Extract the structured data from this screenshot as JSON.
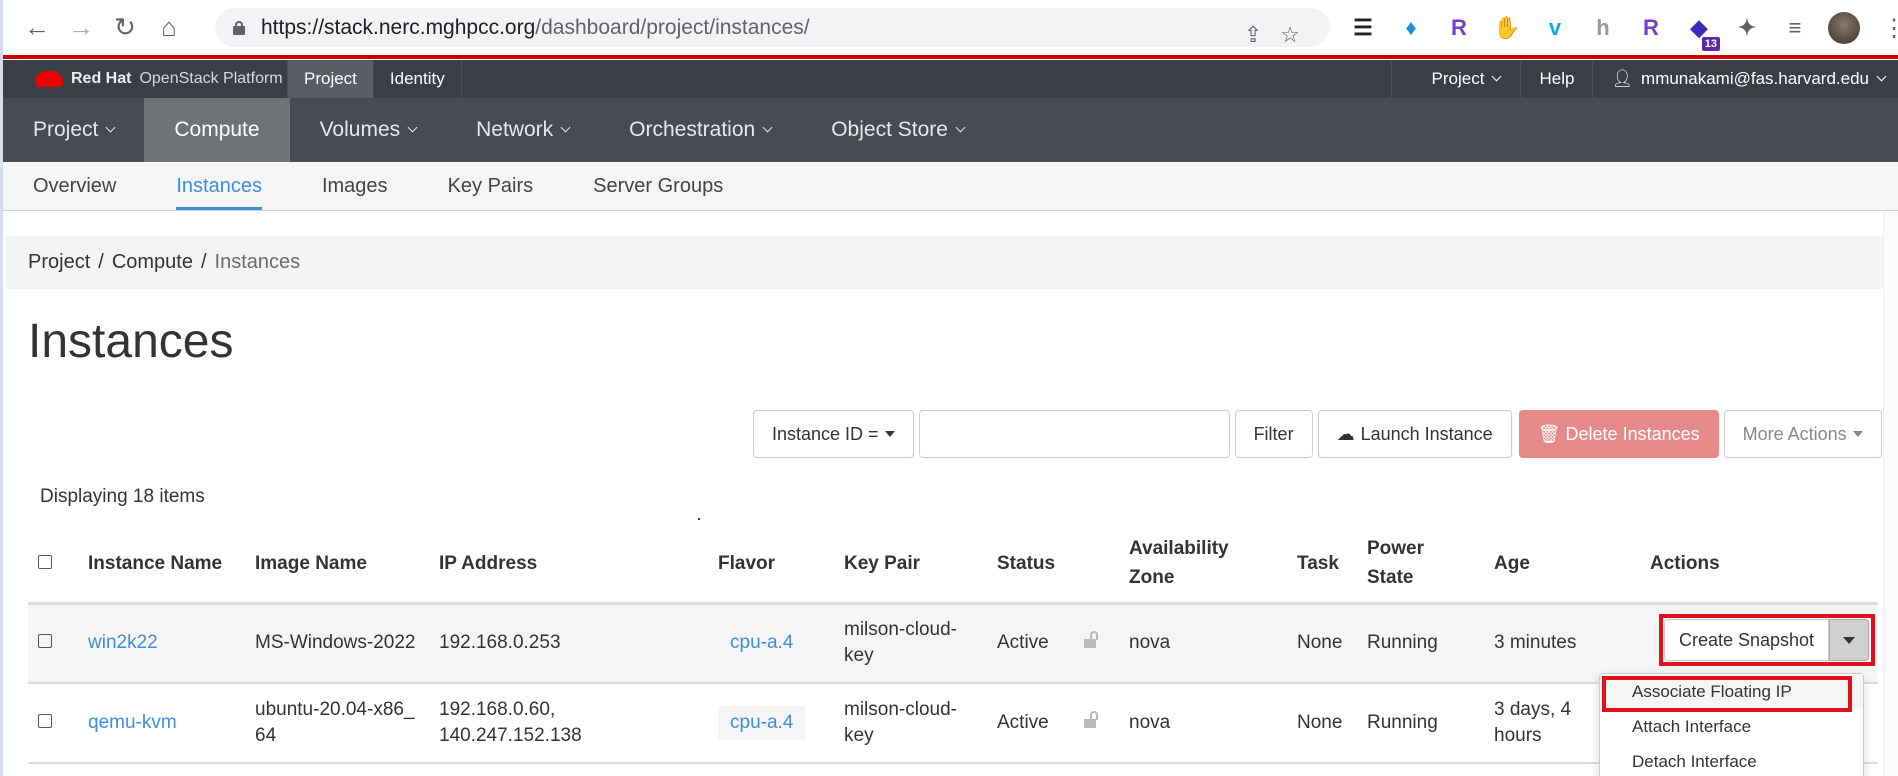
{
  "browser": {
    "url_host": "https://stack.nerc.mghpcc.org",
    "url_path": "/dashboard/project/instances/",
    "nav": [
      "arrow-left-icon",
      "arrow-right-icon",
      "reload-icon",
      "home-icon"
    ],
    "extensions": [
      {
        "name": "tab-search-icon",
        "glyph": "☰",
        "color": "#222"
      },
      {
        "name": "diamond-extension-icon",
        "glyph": "♦",
        "color": "#1a8fd8"
      },
      {
        "name": "r-extension-icon",
        "glyph": "R",
        "color": "#7b3fc4"
      },
      {
        "name": "adblock-icon",
        "glyph": "✋",
        "color": "#e00"
      },
      {
        "name": "vimeo-icon",
        "glyph": "v",
        "color": "#17a7e0"
      },
      {
        "name": "h-extension-icon",
        "glyph": "h",
        "color": "#999"
      },
      {
        "name": "script-r-extension-icon",
        "glyph": "R",
        "color": "#7b3fc4"
      },
      {
        "name": "graduation-extension-icon",
        "glyph": "◆",
        "color": "#3b2bbd",
        "badge": "13"
      },
      {
        "name": "puzzle-icon",
        "glyph": "✦",
        "color": "#5f6368"
      },
      {
        "name": "media-list-icon",
        "glyph": "≡",
        "color": "#5f6368"
      }
    ]
  },
  "topnav": {
    "brand_bold": "Red Hat",
    "brand_rest": "OpenStack Platform",
    "tabs": [
      {
        "label": "Project",
        "active": true
      },
      {
        "label": "Identity",
        "active": false
      }
    ],
    "right": {
      "project": "Project",
      "help": "Help",
      "user": "mmunakami@fas.harvard.edu"
    }
  },
  "mainnav": [
    {
      "label": "Project",
      "dropdown": true
    },
    {
      "label": "Compute",
      "dropdown": false,
      "active": true
    },
    {
      "label": "Volumes",
      "dropdown": true
    },
    {
      "label": "Network",
      "dropdown": true
    },
    {
      "label": "Orchestration",
      "dropdown": true
    },
    {
      "label": "Object Store",
      "dropdown": true
    }
  ],
  "subnav": [
    {
      "label": "Overview"
    },
    {
      "label": "Instances",
      "active": true
    },
    {
      "label": "Images"
    },
    {
      "label": "Key Pairs"
    },
    {
      "label": "Server Groups"
    }
  ],
  "breadcrumb": [
    "Project",
    "Compute",
    "Instances"
  ],
  "page_title": "Instances",
  "toolbar": {
    "filter_field": "Instance ID =",
    "filter_value": "",
    "filter": "Filter",
    "launch": "Launch Instance",
    "delete": "Delete Instances",
    "more": "More Actions"
  },
  "count_text": "Displaying 18 items",
  "table": {
    "headers": [
      "Instance Name",
      "Image Name",
      "IP Address",
      "Flavor",
      "Key Pair",
      "Status",
      "",
      "Availability Zone",
      "Task",
      "Power State",
      "Age",
      "Actions"
    ],
    "rows": [
      {
        "name": "win2k22",
        "image": "MS-Windows-2022",
        "ip": [
          "192.168.0.253"
        ],
        "flavor": "cpu-a.4",
        "keypair": "milson-cloud-key",
        "status": "Active",
        "zone": "nova",
        "task": "None",
        "power": "Running",
        "age": "3 minutes"
      },
      {
        "name": "qemu-kvm",
        "image": "ubuntu-20.04-x86_64",
        "ip": [
          "192.168.0.60,",
          "140.247.152.138"
        ],
        "flavor": "cpu-a.4",
        "keypair": "milson-cloud-key",
        "status": "Active",
        "zone": "nova",
        "task": "None",
        "power": "Running",
        "age": "3 days, 4 hours"
      }
    ]
  },
  "actions": {
    "primary": "Create Snapshot",
    "menu": [
      "Associate Floating IP",
      "Attach Interface",
      "Detach Interface"
    ]
  },
  "colors": {
    "accent": "#3e8ede",
    "danger": "#e58a88",
    "highlight": "#e0101c",
    "brand_red": "#cc0000"
  }
}
